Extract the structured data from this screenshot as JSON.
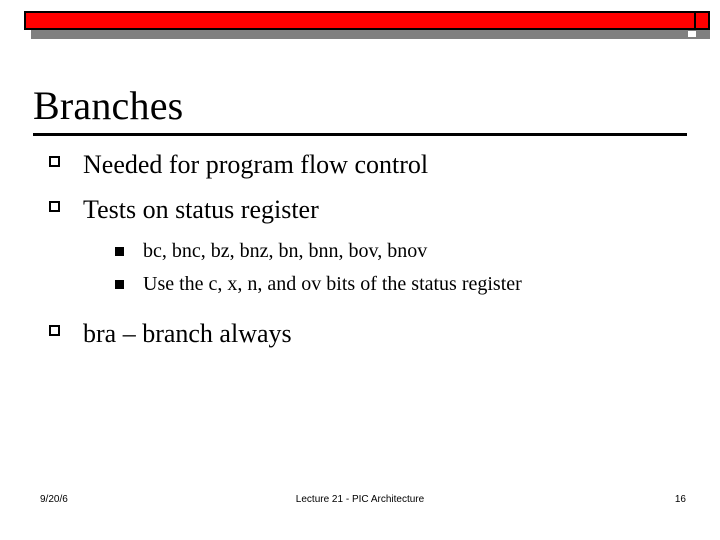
{
  "slide": {
    "title": "Branches",
    "bullets": [
      {
        "level": 1,
        "text": "Needed for program flow control"
      },
      {
        "level": 1,
        "text": "Tests on status register"
      },
      {
        "level": 2,
        "text": "bc, bnc, bz, bnz, bn, bnn, bov, bnov"
      },
      {
        "level": 2,
        "text": "Use the c, x, n, and ov bits of the status register"
      },
      {
        "level": 1,
        "text": "bra – branch always"
      }
    ],
    "footer": {
      "date": "9/20/6",
      "center": "Lecture 21 - PIC Architecture",
      "page": "16"
    },
    "colors": {
      "accent_bar": "#ff0000",
      "bar_shadow": "#808080",
      "text": "#000000",
      "background": "#ffffff"
    }
  }
}
